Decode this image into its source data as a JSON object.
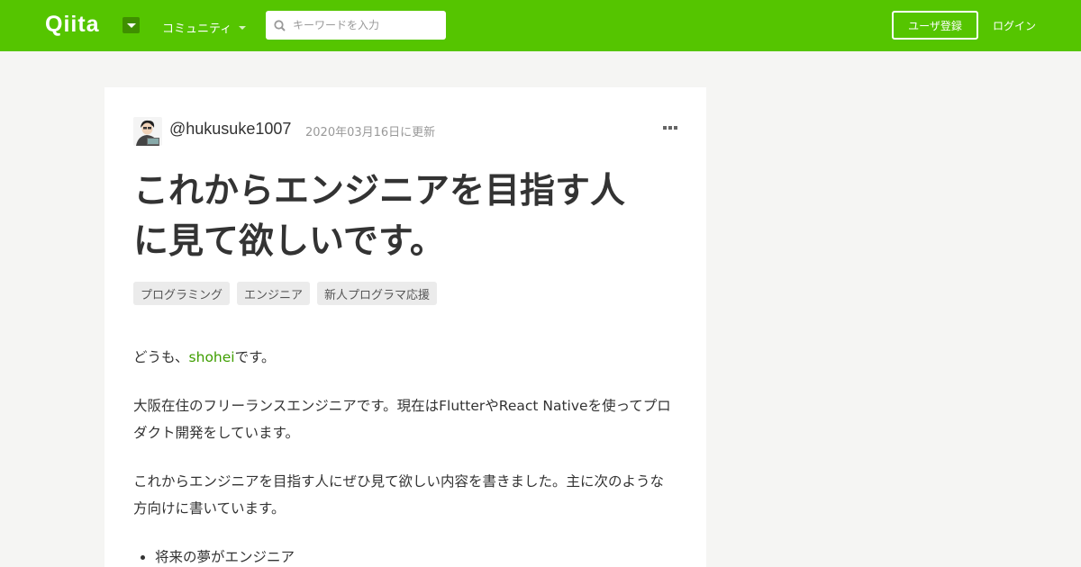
{
  "header": {
    "logo": "Qiita",
    "community_label": "コミュニティ",
    "search_placeholder": "キーワードを入力",
    "signup_label": "ユーザ登録",
    "login_label": "ログイン",
    "brand_color": "#55c500"
  },
  "article": {
    "author": "@hukusuke1007",
    "date": "2020年03月16日に更新",
    "title_line1": "これからエンジニアを目指す人",
    "title_line2": "に見て欲しいです。",
    "tags": [
      "プログラミング",
      "エンジニア",
      "新人プログラマ応援"
    ],
    "intro_prefix": "どうも、",
    "intro_link": "shohei",
    "intro_suffix": "です。",
    "para2": "大阪在住のフリーランスエンジニアです。現在はFlutterやReact Nativeを使ってプロダクト開発をしています。",
    "para3": "これからエンジニアを目指す人にぜひ見て欲しい内容を書きました。主に次のような方向けに書いています。",
    "list": [
      "将来の夢がエンジニア"
    ]
  },
  "icons": {
    "search": "search-icon",
    "menu_toggle": "chevron-down-icon",
    "more": "more-options-icon"
  }
}
